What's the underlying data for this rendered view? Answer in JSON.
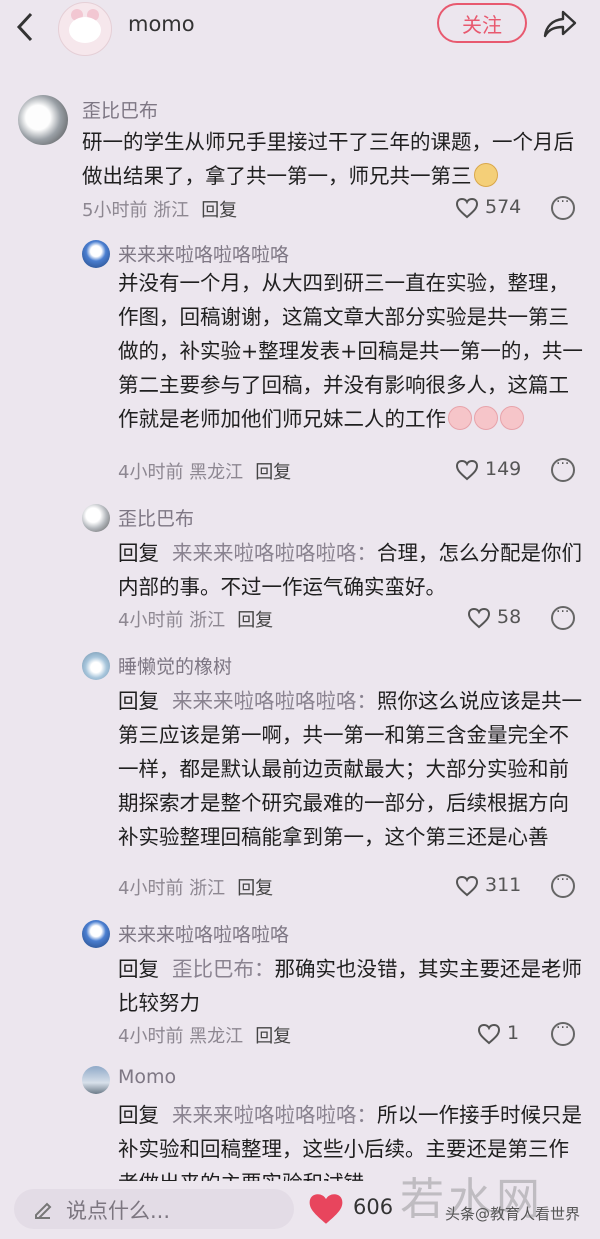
{
  "header": {
    "back_icon": "back-chevron-icon",
    "username": "momo",
    "follow_label": "关注",
    "share_icon": "share-arrow-icon",
    "accent_color": "#e8596f"
  },
  "comments": [
    {
      "user": "歪比巴布",
      "text": "研一的学生从师兄手里接过干了三年的课题，一个月后做出结果了，拿了共一第一，师兄共一第三",
      "time_location": "5小时前 浙江",
      "reply_label": "回复",
      "likes": "574"
    },
    {
      "user": "来来来啦咯啦咯啦咯",
      "text": "并没有一个月，从大四到研三一直在实验，整理，作图，回稿谢谢，这篇文章大部分实验是共一第三做的，补实验+整理发表+回稿是共一第一的，共一第二主要参与了回稿，并没有影响很多人，这篇工作就是老师加他们师兄妹二人的工作",
      "time_location": "4小时前 黑龙江",
      "reply_label": "回复",
      "likes": "149"
    },
    {
      "user": "歪比巴布",
      "reply_prefix": "回复",
      "reply_to": "来来来啦咯啦咯啦咯：",
      "text": "合理，怎么分配是你们内部的事。不过一作运气确实蛮好。",
      "time_location": "4小时前 浙江",
      "reply_label": "回复",
      "likes": "58"
    },
    {
      "user": "睡懒觉的橡树",
      "reply_prefix": "回复",
      "reply_to": "来来来啦咯啦咯啦咯：",
      "text": "照你这么说应该是共一第三应该是第一啊，共一第一和第三含金量完全不一样，都是默认最前边贡献最大；大部分实验和前期探索才是整个研究最难的一部分，后续根据方向补实验整理回稿能拿到第一，这个第三还是心善",
      "time_location": "4小时前 浙江",
      "reply_label": "回复",
      "likes": "311"
    },
    {
      "user": "来来来啦咯啦咯啦咯",
      "reply_prefix": "回复",
      "reply_to": "歪比巴布：",
      "text": "那确实也没错，其实主要还是老师比较努力",
      "time_location": "4小时前 黑龙江",
      "reply_label": "回复",
      "likes": "1"
    },
    {
      "user": "Momo",
      "reply_prefix": "回复",
      "reply_to": "来来来啦咯啦咯啦咯：",
      "text": "所以一作接手时候只是补实验和回稿整理，这些小后续。主要还是第三作者做出来的主要实验和试错"
    }
  ],
  "bottom_bar": {
    "input_placeholder": "说点什么...",
    "like_count": "606",
    "watermark": "若水网",
    "watermark_small": "头条@教育人看世界"
  }
}
